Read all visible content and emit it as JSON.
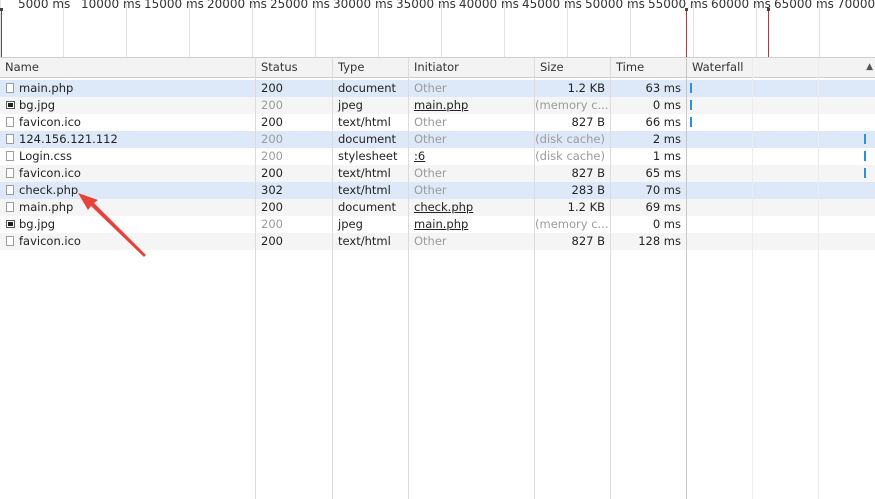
{
  "overview": {
    "ticks": [
      "5000 ms",
      "10000 ms",
      "15000 ms",
      "20000 ms",
      "25000 ms",
      "30000 ms",
      "35000 ms",
      "40000 ms",
      "45000 ms",
      "50000 ms",
      "55000 ms",
      "60000 ms",
      "65000 ms",
      "70000 ms"
    ]
  },
  "columns": {
    "name": "Name",
    "status": "Status",
    "type": "Type",
    "initiator": "Initiator",
    "size": "Size",
    "time": "Time",
    "waterfall": "Waterfall"
  },
  "rows": [
    {
      "name": "main.php",
      "icon": "file",
      "status": "200",
      "type": "document",
      "initiator": "Other",
      "initiator_link": false,
      "size": "1.2 KB",
      "size_gray": false,
      "time": "63 ms",
      "status_gray": false
    },
    {
      "name": "bg.jpg",
      "icon": "image",
      "status": "200",
      "type": "jpeg",
      "initiator": "main.php",
      "initiator_link": true,
      "size": "(memory c...",
      "size_gray": true,
      "time": "0 ms",
      "status_gray": true
    },
    {
      "name": "favicon.ico",
      "icon": "file",
      "status": "200",
      "type": "text/html",
      "initiator": "Other",
      "initiator_link": false,
      "size": "827 B",
      "size_gray": false,
      "time": "66 ms",
      "status_gray": false
    },
    {
      "name": "124.156.121.112",
      "icon": "file",
      "status": "200",
      "type": "document",
      "initiator": "Other",
      "initiator_link": false,
      "size": "(disk cache)",
      "size_gray": true,
      "time": "2 ms",
      "status_gray": true
    },
    {
      "name": "Login.css",
      "icon": "file",
      "status": "200",
      "type": "stylesheet",
      "initiator": ":6",
      "initiator_link": true,
      "size": "(disk cache)",
      "size_gray": true,
      "time": "1 ms",
      "status_gray": true
    },
    {
      "name": "favicon.ico",
      "icon": "file",
      "status": "200",
      "type": "text/html",
      "initiator": "Other",
      "initiator_link": false,
      "size": "827 B",
      "size_gray": false,
      "time": "65 ms",
      "status_gray": false
    },
    {
      "name": "check.php",
      "icon": "file",
      "status": "302",
      "type": "text/html",
      "initiator": "Other",
      "initiator_link": false,
      "size": "283 B",
      "size_gray": false,
      "time": "70 ms",
      "status_gray": false
    },
    {
      "name": "main.php",
      "icon": "file",
      "status": "200",
      "type": "document",
      "initiator": "check.php",
      "initiator_link": true,
      "size": "1.2 KB",
      "size_gray": false,
      "time": "69 ms",
      "status_gray": false
    },
    {
      "name": "bg.jpg",
      "icon": "image",
      "status": "200",
      "type": "jpeg",
      "initiator": "main.php",
      "initiator_link": true,
      "size": "(memory c...",
      "size_gray": true,
      "time": "0 ms",
      "status_gray": true
    },
    {
      "name": "favicon.ico",
      "icon": "file",
      "status": "200",
      "type": "text/html",
      "initiator": "Other",
      "initiator_link": false,
      "size": "827 B",
      "size_gray": false,
      "time": "128 ms",
      "status_gray": false
    }
  ],
  "colors": {
    "selected_row": "#dde9f9",
    "waterfall_bar": "#2d8fdf",
    "annotation_arrow": "#e8403a",
    "marker_line": "#b3363a"
  }
}
